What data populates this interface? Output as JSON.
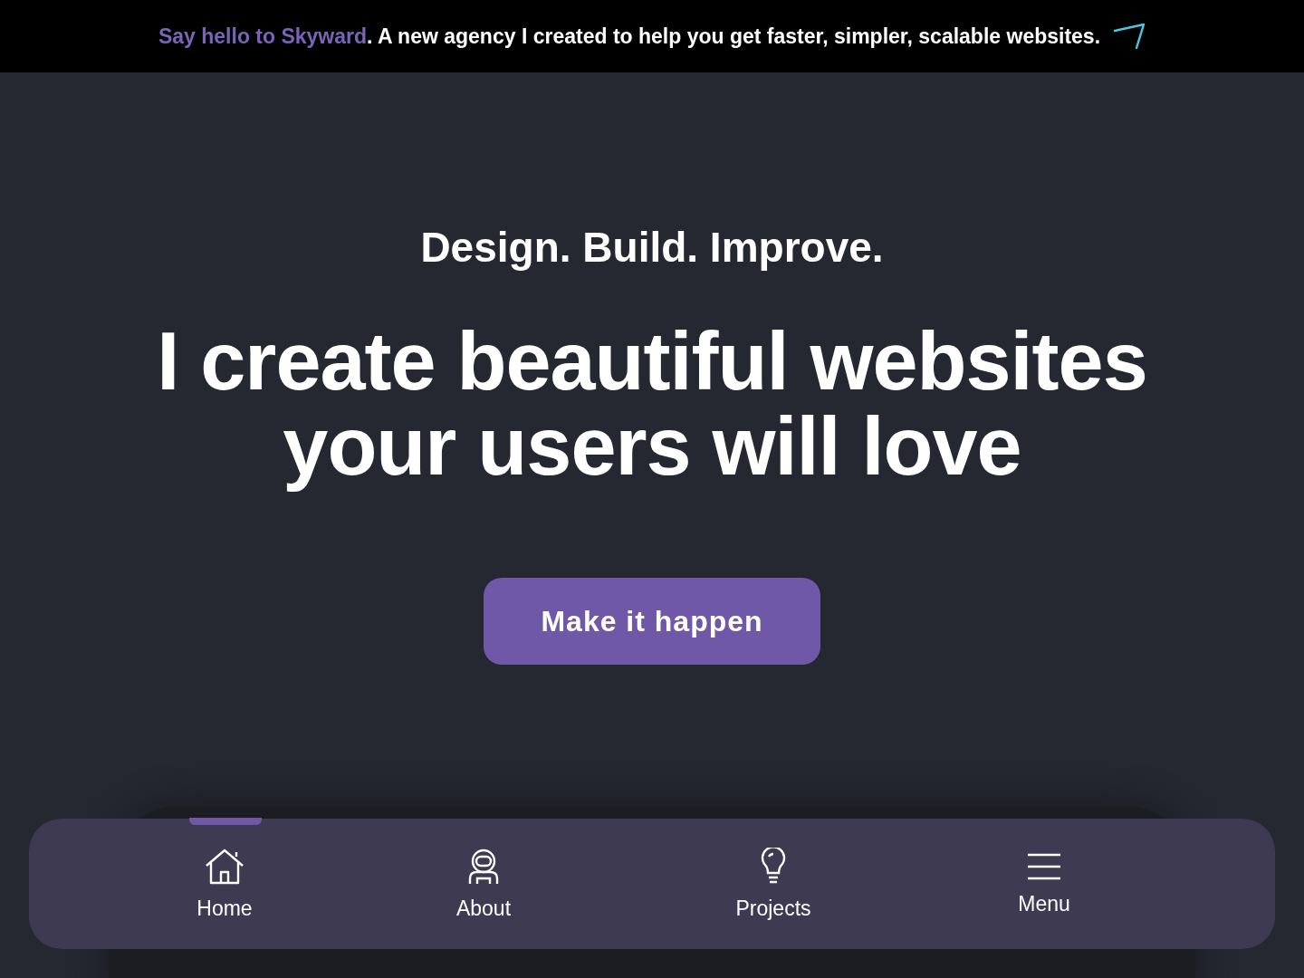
{
  "banner": {
    "brand": "Say hello to Skyward",
    "text": ". A new agency I created to help you get faster, simpler, scalable websites."
  },
  "hero": {
    "tagline": "Design. Build. Improve.",
    "headline_lines": [
      "I create beautiful websites",
      "your users will love"
    ],
    "cta": "Make it happen"
  },
  "bottom_nav": [
    {
      "kind": "home",
      "label": "Home",
      "selected": true
    },
    {
      "kind": "about",
      "label": "About",
      "selected": false
    },
    {
      "kind": "projects",
      "label": "Projects",
      "selected": false
    },
    {
      "kind": "menu",
      "label": "Menu",
      "selected": false
    }
  ]
}
